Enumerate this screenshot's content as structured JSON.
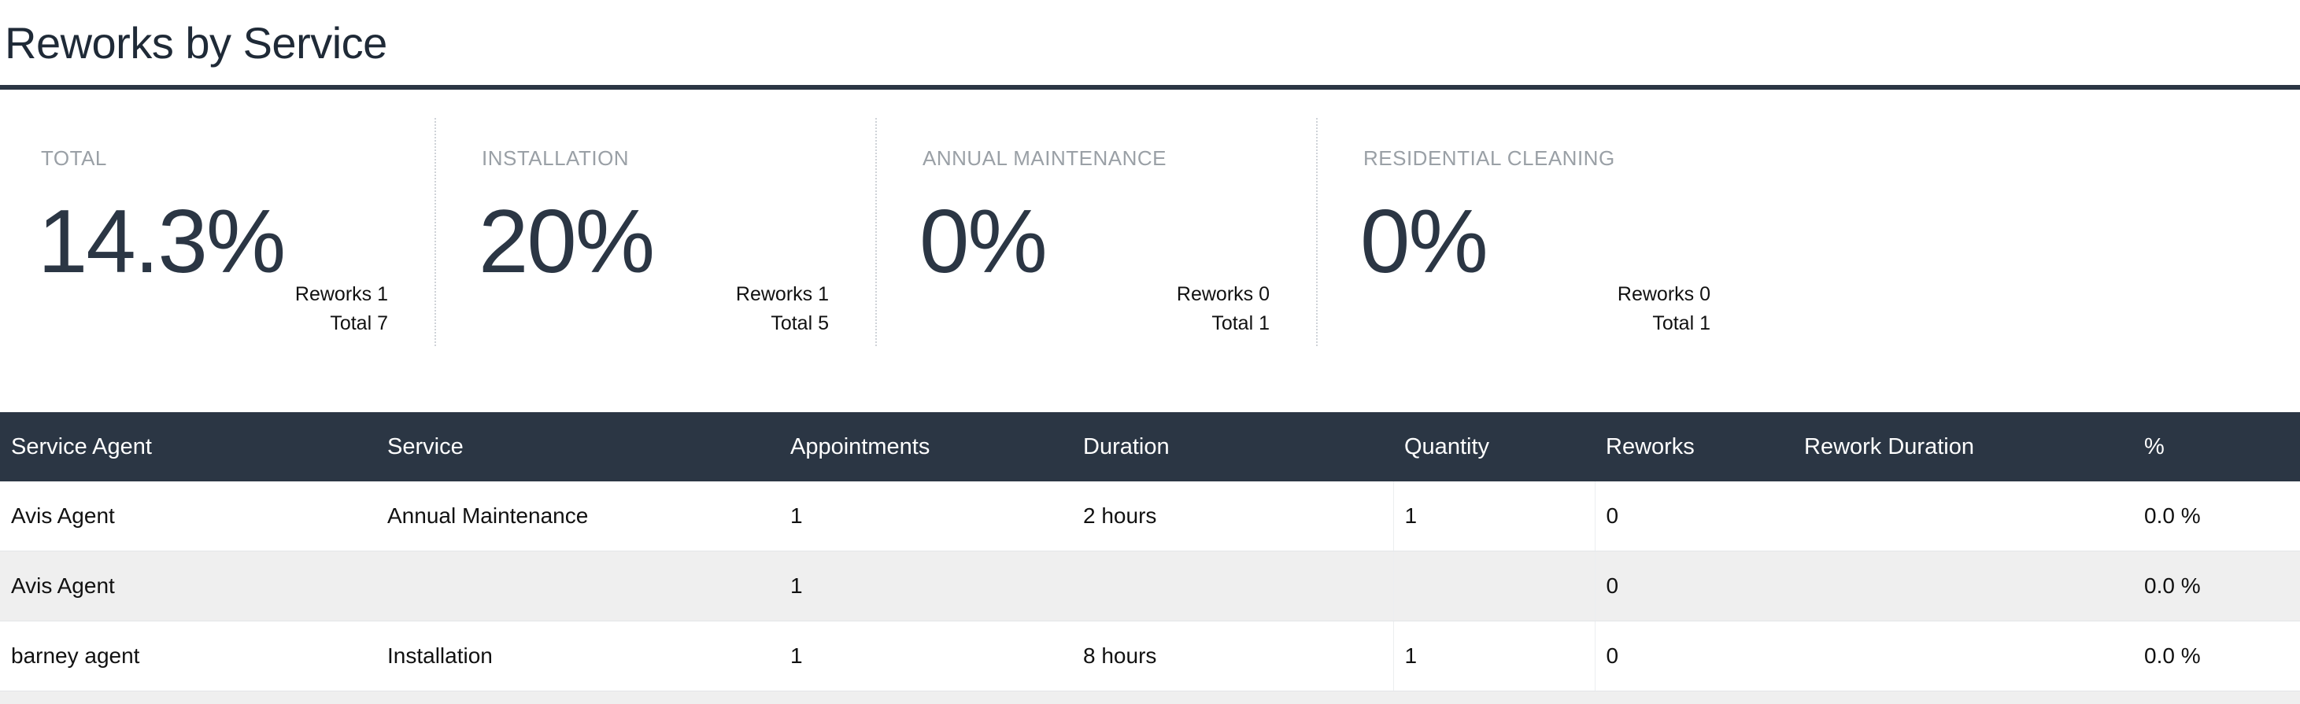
{
  "page": {
    "title": "Reworks by Service"
  },
  "kpis": [
    {
      "label": "TOTAL",
      "value": "14.3%",
      "reworks": "Reworks 1",
      "total": "Total 7"
    },
    {
      "label": "INSTALLATION",
      "value": "20%",
      "reworks": "Reworks 1",
      "total": "Total 5"
    },
    {
      "label": "ANNUAL MAINTENANCE",
      "value": "0%",
      "reworks": "Reworks 0",
      "total": "Total 1"
    },
    {
      "label": "RESIDENTIAL CLEANING",
      "value": "0%",
      "reworks": "Reworks 0",
      "total": "Total 1"
    }
  ],
  "table": {
    "headers": [
      "Service Agent",
      "Service",
      "Appointments",
      "Duration",
      "Quantity",
      "Reworks",
      "Rework Duration",
      "%"
    ],
    "rows": [
      [
        "Avis Agent",
        "Annual Maintenance",
        "1",
        "2 hours",
        "1",
        "0",
        "",
        "0.0 %"
      ],
      [
        "Avis Agent",
        "",
        "1",
        "",
        "",
        "0",
        "",
        "0.0 %"
      ],
      [
        "barney agent",
        "Installation",
        "1",
        "8 hours",
        "1",
        "0",
        "",
        "0.0 %"
      ]
    ]
  },
  "colors": {
    "header_bg": "#2b3644",
    "row_alt": "#efefef",
    "label_gray": "#9aa0a6"
  }
}
